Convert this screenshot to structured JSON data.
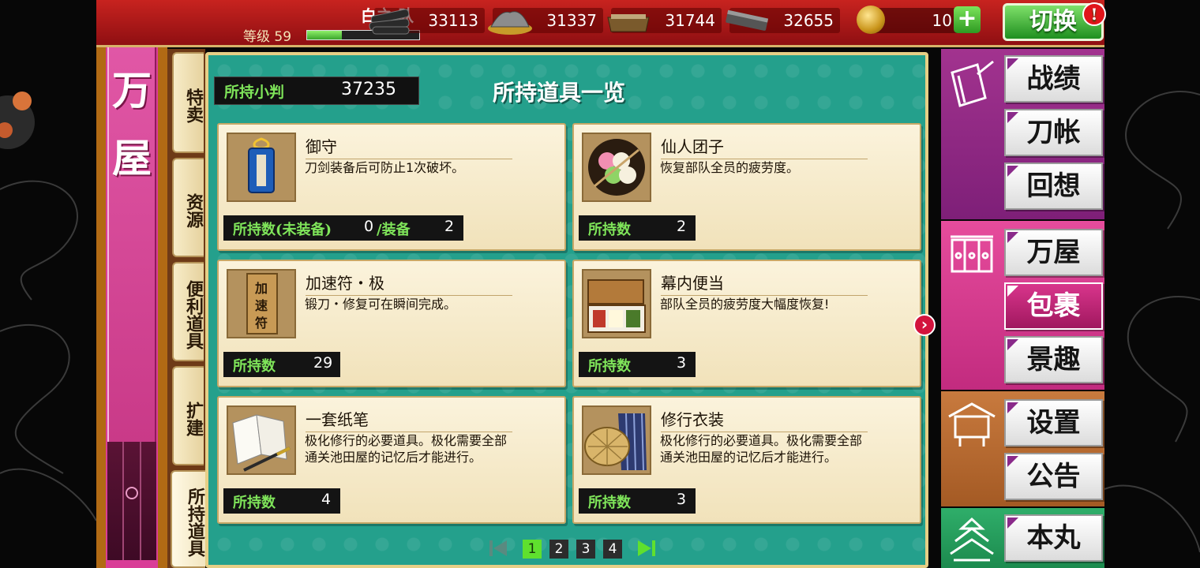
{
  "player": {
    "team_name": "白之 队",
    "level_label": "等级",
    "level": "59",
    "exp_fraction": 0.31
  },
  "resources": [
    {
      "icon": "charcoal-icon",
      "value": "33113"
    },
    {
      "icon": "steel-icon",
      "value": "31337"
    },
    {
      "icon": "coolant-icon",
      "value": "31744"
    },
    {
      "icon": "whetstone-icon",
      "value": "32655"
    }
  ],
  "koban_currency": {
    "icon": "gold-coin-icon",
    "value": "10",
    "add_label": "+"
  },
  "switch_button": {
    "label": "切换",
    "badge": "!"
  },
  "shop": {
    "title": "万屋"
  },
  "category_tabs": [
    {
      "label": "特卖",
      "active": false
    },
    {
      "label": "资源",
      "active": false
    },
    {
      "label": "便利道具",
      "active": false
    },
    {
      "label": "扩建",
      "active": false
    },
    {
      "label": "所持道具",
      "active": true
    }
  ],
  "panel": {
    "koban_label": "所持小判",
    "koban_value": "37235",
    "title": "所持道具一览"
  },
  "items": [
    {
      "icon": "omamori-icon",
      "name": "御守",
      "desc": "刀剑装备后可防止1次破坏。",
      "owned_label": "所持数(未装备)",
      "owned_value": "0",
      "equipped_label": "/装备",
      "equipped_value": "2"
    },
    {
      "icon": "dango-icon",
      "name": "仙人团子",
      "desc": "恢复部队全员的疲劳度。",
      "owned_label": "所持数",
      "owned_value": "2"
    },
    {
      "icon": "speedup-charm-icon",
      "name": "加速符・极",
      "desc": "锻刀・修复可在瞬间完成。",
      "owned_label": "所持数",
      "owned_value": "29"
    },
    {
      "icon": "bento-icon",
      "name": "幕内便当",
      "desc": "部队全员的疲劳度大幅度恢复!",
      "owned_label": "所持数",
      "owned_value": "3"
    },
    {
      "icon": "paper-brush-icon",
      "name": "一套纸笔",
      "desc_lines": [
        "极化修行的必要道具。极化需要全部",
        "通关池田屋的记忆后才能进行。"
      ],
      "owned_label": "所持数",
      "owned_value": "4"
    },
    {
      "icon": "travel-outfit-icon",
      "name": "修行衣装",
      "desc_lines": [
        "极化修行的必要道具。极化需要全部",
        "通关池田屋的记忆后才能进行。"
      ],
      "owned_label": "所持数",
      "owned_value": "3"
    }
  ],
  "pagination": {
    "pages": [
      "1",
      "2",
      "3",
      "4"
    ],
    "current": "1"
  },
  "right_menu": [
    {
      "icon": "record-book-icon",
      "buttons": [
        {
          "label": "战绩"
        },
        {
          "label": "刀帐"
        },
        {
          "label": "回想"
        }
      ]
    },
    {
      "icon": "noren-curtain-icon",
      "buttons": [
        {
          "label": "万屋"
        },
        {
          "label": "包裹",
          "active": true
        },
        {
          "label": "景趣"
        }
      ]
    },
    {
      "icon": "notice-board-icon",
      "buttons": [
        {
          "label": "设置"
        },
        {
          "label": "公告"
        }
      ]
    },
    {
      "icon": "castle-icon",
      "buttons": [
        {
          "label": "本丸"
        }
      ]
    }
  ],
  "colors": {
    "accent_green": "#7fe55a",
    "panel_teal": "#24a08c",
    "shop_magenta": "#d93d97",
    "topbar_red": "#c8231f"
  }
}
